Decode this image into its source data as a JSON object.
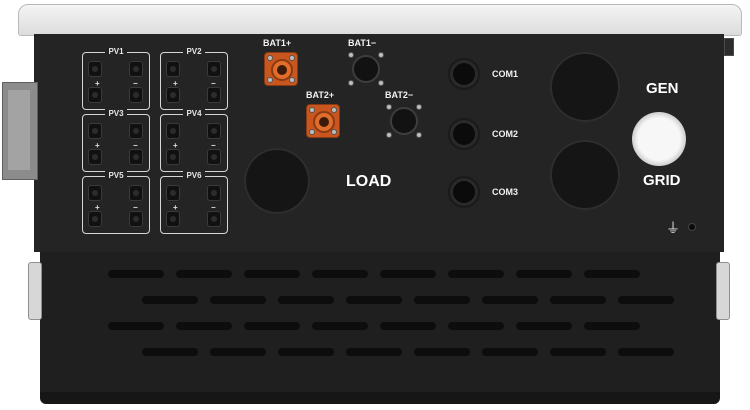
{
  "labels": {
    "pv": [
      "PV1",
      "PV2",
      "PV3",
      "PV4",
      "PV5",
      "PV6"
    ],
    "plus": "+",
    "minus": "−",
    "bat1_plus": "BAT1+",
    "bat1_minus": "BAT1−",
    "bat2_plus": "BAT2+",
    "bat2_minus": "BAT2−",
    "load": "LOAD",
    "com1": "COM1",
    "com2": "COM2",
    "com3": "COM3",
    "gen": "GEN",
    "grid": "GRID",
    "ground_symbol": "⏚"
  },
  "colors": {
    "body": "#242424",
    "lid": "#e6e6e6",
    "battery_terminal": "#c9561e",
    "switch": "#f2f2f2"
  }
}
